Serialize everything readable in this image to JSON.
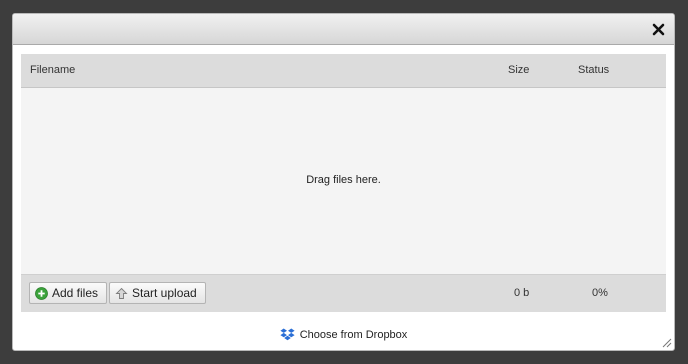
{
  "dialog": {
    "close_icon": "close-icon"
  },
  "table": {
    "headers": {
      "filename": "Filename",
      "size": "Size",
      "status": "Status"
    },
    "drop_message": "Drag files here."
  },
  "footer": {
    "add_files_label": "Add files",
    "start_upload_label": "Start upload",
    "total_size": "0 b",
    "total_status": "0%"
  },
  "dropbox": {
    "label": "Choose from Dropbox",
    "icon": "dropbox-icon",
    "color": "#2b6fd6"
  },
  "colors": {
    "add_icon": "#3aa23a"
  }
}
